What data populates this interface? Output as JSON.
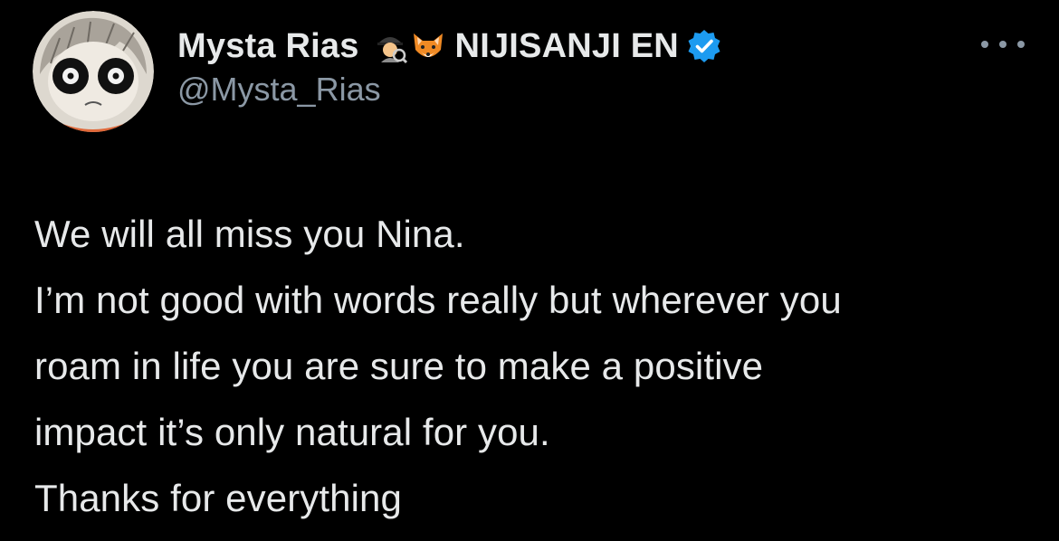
{
  "tweet": {
    "author": {
      "display_name": "Mysta Rias",
      "affiliation": "NIJISANJI EN",
      "handle": "@Mysta_Rias",
      "emojis": [
        "detective-emoji",
        "fox-emoji"
      ],
      "verified": true,
      "verified_color": "#1d9bf0"
    },
    "lines": [
      "We will all miss you Nina.",
      "I’m not good with words really but wherever you",
      "roam in life you are sure to make a positive",
      "impact it’s only natural for you.",
      "Thanks for everything"
    ],
    "more_icon": "more-horizontal-icon"
  },
  "theme": {
    "background": "#000000",
    "text": "#e7e9ea",
    "secondary_text": "#8b98a5"
  }
}
